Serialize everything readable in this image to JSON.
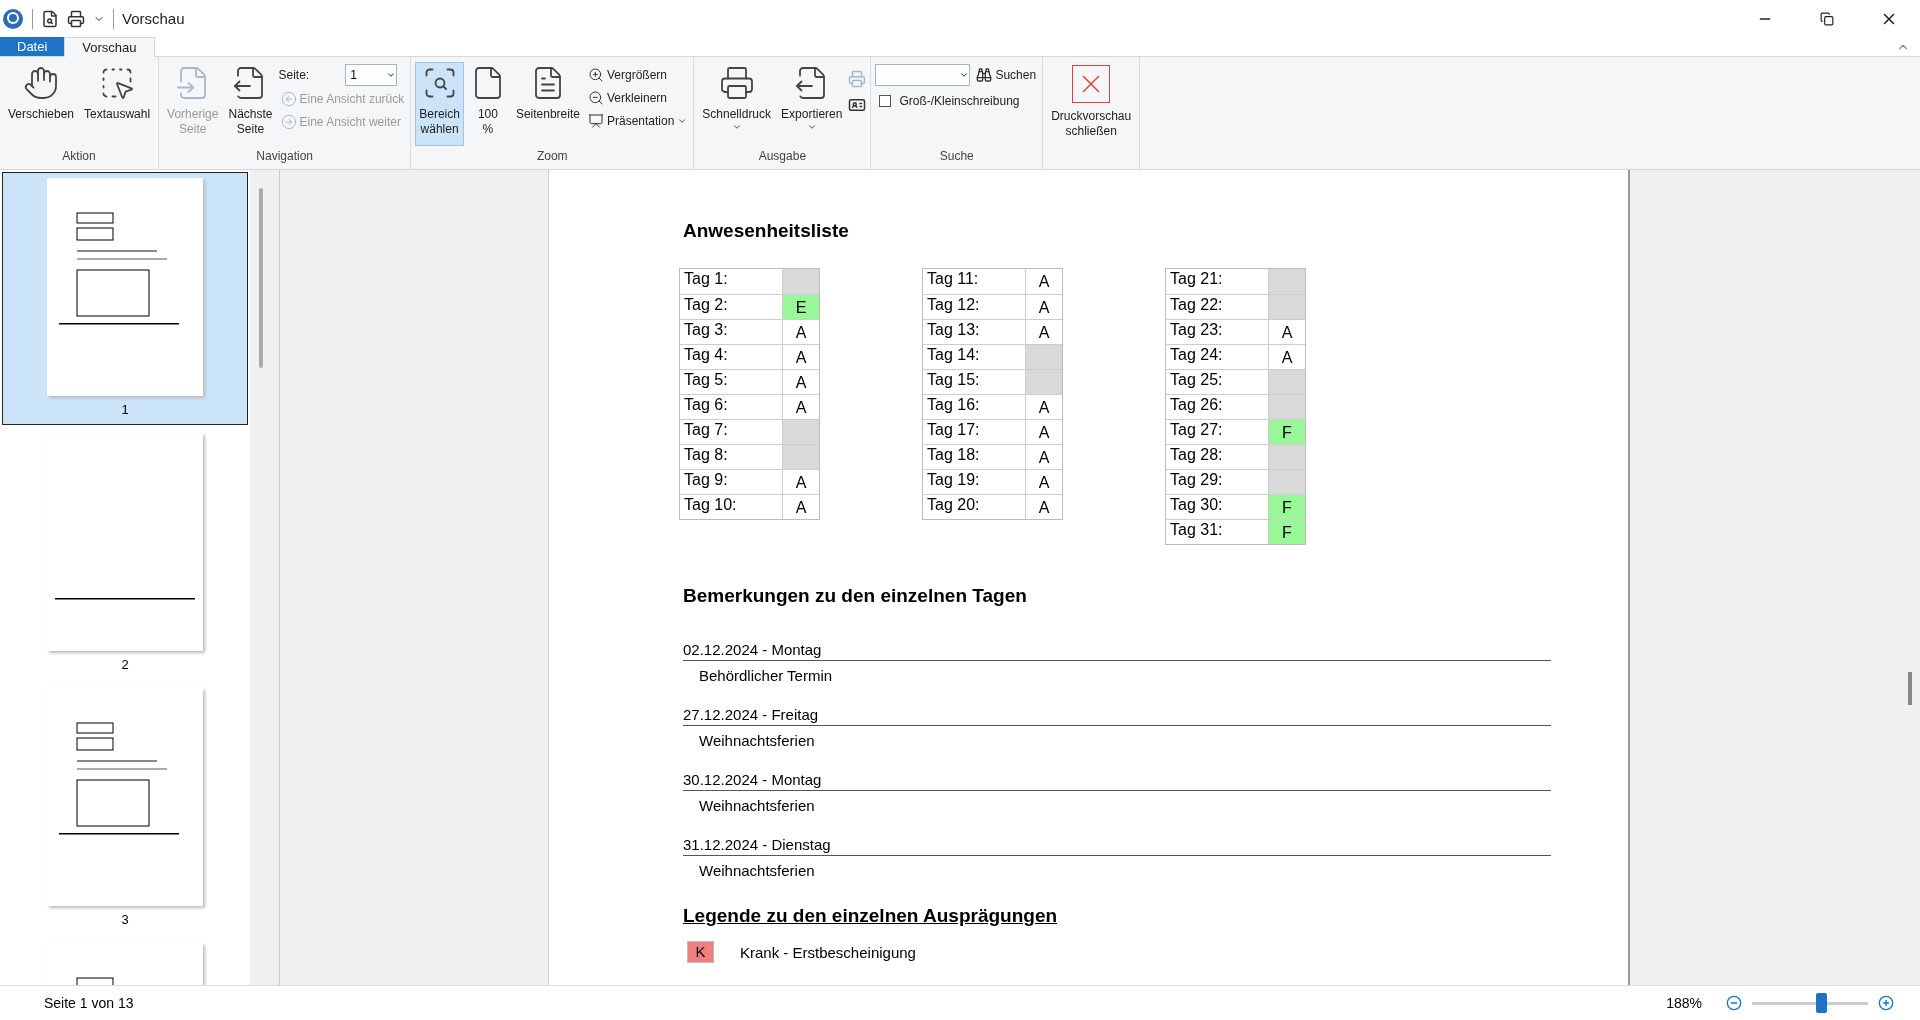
{
  "window": {
    "title": "Vorschau"
  },
  "tabs": [
    {
      "label": "Datei",
      "kind": "file",
      "selected": false
    },
    {
      "label": "Vorschau",
      "kind": "tab",
      "selected": true
    }
  ],
  "ribbon": {
    "groups": [
      {
        "label": "Aktion",
        "items": [
          {
            "kind": "large",
            "lines": [
              "Verschieben"
            ],
            "selected": false
          },
          {
            "kind": "large",
            "lines": [
              "Textauswahl"
            ],
            "selected": false
          }
        ]
      },
      {
        "label": "Navigation",
        "items": [
          {
            "kind": "large",
            "lines": [
              "Vorherige",
              "Seite"
            ],
            "disabled": true
          },
          {
            "kind": "large",
            "lines": [
              "Nächste",
              "Seite"
            ],
            "disabled": false
          },
          {
            "kind": "stack",
            "items": [
              {
                "kind": "field",
                "label": "Seite:",
                "value": "1"
              },
              {
                "kind": "small",
                "label": "Eine Ansicht zurück",
                "disabled": true
              },
              {
                "kind": "small",
                "label": "Eine Ansicht weiter",
                "disabled": true
              }
            ]
          }
        ]
      },
      {
        "label": "Zoom",
        "items": [
          {
            "kind": "large",
            "lines": [
              "Bereich",
              "wählen"
            ],
            "selected": true
          },
          {
            "kind": "large",
            "lines": [
              "100",
              "%"
            ],
            "selected": false
          },
          {
            "kind": "large",
            "lines": [
              "Seitenbreite"
            ],
            "selected": false
          },
          {
            "kind": "stack",
            "items": [
              {
                "kind": "small",
                "label": "Vergrößern",
                "disabled": false
              },
              {
                "kind": "small",
                "label": "Verkleinern",
                "disabled": false
              },
              {
                "kind": "small",
                "label": "Präsentation",
                "disabled": false,
                "menu": true
              }
            ]
          }
        ]
      },
      {
        "label": "Ausgabe",
        "items": [
          {
            "kind": "large",
            "lines": [
              "Schnelldruck"
            ],
            "menu": true
          },
          {
            "kind": "large",
            "lines": [
              "Exportieren"
            ],
            "menu": true
          },
          {
            "kind": "iconstack",
            "items": [
              {
                "disabled": true
              },
              {
                "disabled": false
              }
            ]
          }
        ]
      },
      {
        "label": "Suche",
        "items": [
          {
            "kind": "stack",
            "items": [
              {
                "kind": "search",
                "button": "Suchen"
              },
              {
                "kind": "checkbox",
                "label": "Groß-/Kleinschreibung",
                "checked": false
              }
            ]
          }
        ]
      },
      {
        "items": [
          {
            "kind": "large",
            "lines": [
              "Druckvorschau",
              "schließen"
            ]
          }
        ]
      }
    ]
  },
  "thumbnails": [
    {
      "label": "1",
      "selected": true
    },
    {
      "label": "2",
      "selected": false
    },
    {
      "label": "3",
      "selected": false
    },
    {
      "selected": false
    }
  ],
  "document": {
    "heading": "Anwesenheitsliste",
    "attendance": [
      [
        {
          "label": "Tag 1:",
          "color": "#d9d9d9"
        },
        {
          "label": "Tag 2:",
          "value": "E",
          "color": "#98f898"
        },
        {
          "label": "Tag 3:",
          "value": "A",
          "color": "#ffffff"
        },
        {
          "label": "Tag 4:",
          "value": "A",
          "color": "#ffffff"
        },
        {
          "label": "Tag 5:",
          "value": "A",
          "color": "#ffffff"
        },
        {
          "label": "Tag 6:",
          "value": "A",
          "color": "#ffffff"
        },
        {
          "label": "Tag 7:",
          "color": "#d9d9d9"
        },
        {
          "label": "Tag 8:",
          "color": "#d9d9d9"
        },
        {
          "label": "Tag 9:",
          "value": "A",
          "color": "#ffffff"
        },
        {
          "label": "Tag 10:",
          "value": "A",
          "color": "#ffffff"
        }
      ],
      [
        {
          "label": "Tag 11:",
          "value": "A",
          "color": "#ffffff"
        },
        {
          "label": "Tag 12:",
          "value": "A",
          "color": "#ffffff"
        },
        {
          "label": "Tag 13:",
          "value": "A",
          "color": "#ffffff"
        },
        {
          "label": "Tag 14:",
          "color": "#d9d9d9"
        },
        {
          "label": "Tag 15:",
          "color": "#d9d9d9"
        },
        {
          "label": "Tag 16:",
          "value": "A",
          "color": "#ffffff"
        },
        {
          "label": "Tag 17:",
          "value": "A",
          "color": "#ffffff"
        },
        {
          "label": "Tag 18:",
          "value": "A",
          "color": "#ffffff"
        },
        {
          "label": "Tag 19:",
          "value": "A",
          "color": "#ffffff"
        },
        {
          "label": "Tag 20:",
          "value": "A",
          "color": "#ffffff"
        }
      ],
      [
        {
          "label": "Tag 21:",
          "color": "#d9d9d9"
        },
        {
          "label": "Tag 22:",
          "color": "#d9d9d9"
        },
        {
          "label": "Tag 23:",
          "value": "A",
          "color": "#ffffff"
        },
        {
          "label": "Tag 24:",
          "value": "A",
          "color": "#ffffff"
        },
        {
          "label": "Tag 25:",
          "color": "#d9d9d9"
        },
        {
          "label": "Tag 26:",
          "color": "#d9d9d9"
        },
        {
          "label": "Tag 27:",
          "value": "F",
          "color": "#98f898"
        },
        {
          "label": "Tag 28:",
          "color": "#d9d9d9"
        },
        {
          "label": "Tag 29:",
          "color": "#d9d9d9"
        },
        {
          "label": "Tag 30:",
          "value": "F",
          "color": "#98f898"
        },
        {
          "label": "Tag 31:",
          "value": "F",
          "color": "#98f898"
        }
      ]
    ],
    "remarks_heading": "Bemerkungen zu den einzelnen Tagen",
    "remarks": [
      {
        "date": "02.12.2024 - Montag",
        "text": "Behördlicher Termin"
      },
      {
        "date": "27.12.2024 - Freitag",
        "text": "Weihnachtsferien"
      },
      {
        "date": "30.12.2024 - Montag",
        "text": "Weihnachtsferien"
      },
      {
        "date": "31.12.2024 - Dienstag",
        "text": "Weihnachtsferien"
      }
    ],
    "legend_heading": "Legende zu den einzelnen Ausprägungen",
    "legend": [
      {
        "code": "K",
        "color": "#f08080",
        "label": "Krank - Erstbescheinigung"
      }
    ]
  },
  "status_bar": {
    "page": "Seite 1 von 13",
    "zoom": "188%",
    "level": 0.61
  }
}
